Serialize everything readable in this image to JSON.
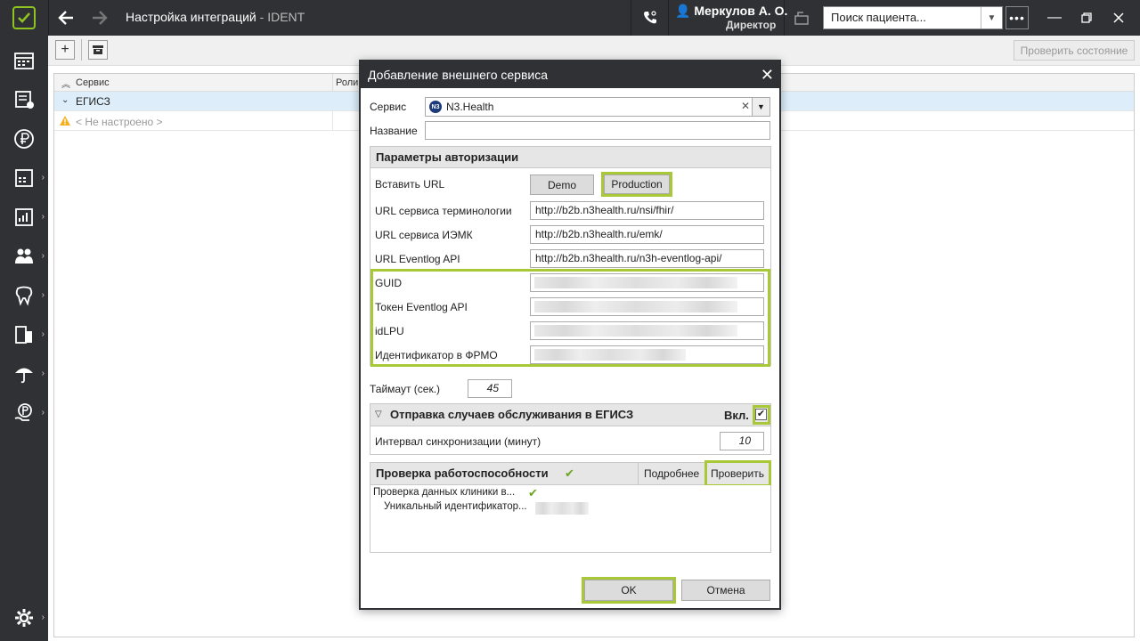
{
  "window": {
    "title": "Настройка интеграций",
    "app": "- IDENT",
    "user_name": "Меркулов А. О.",
    "user_role": "Директор",
    "search_placeholder": "Поиск пациента..."
  },
  "toolbar": {
    "check_state_label": "Проверить состояние"
  },
  "grid": {
    "columns": [
      "Сервис",
      "Роли"
    ],
    "group_row": "ЕГИСЗ",
    "item_row": "< Не настроено >"
  },
  "dialog": {
    "title": "Добавление внешнего сервиса",
    "service_label": "Сервис",
    "service_badge": "N3",
    "service_value": "N3.Health",
    "name_label": "Название",
    "name_value": "",
    "auth_group_title": "Параметры авторизации",
    "insert_url_label": "Вставить URL",
    "demo_button": "Demo",
    "production_button": "Production",
    "fields": [
      {
        "label": "URL сервиса терминологии",
        "value": "http://b2b.n3health.ru/nsi/fhir/"
      },
      {
        "label": "URL сервиса ИЭМК",
        "value": "http://b2b.n3health.ru/emk/"
      },
      {
        "label": "URL Eventlog API",
        "value": "http://b2b.n3health.ru/n3h-eventlog-api/"
      }
    ],
    "secret_fields": [
      {
        "label": "GUID"
      },
      {
        "label": "Токен Eventlog API"
      },
      {
        "label": "idLPU"
      },
      {
        "label": "Идентификатор в ФРМО"
      }
    ],
    "timeout_label": "Таймаут (сек.)",
    "timeout_value": "45",
    "send_group_title": "Отправка случаев обслуживания в ЕГИСЗ",
    "send_enabled_label": "Вкл.",
    "sync_interval_label": "Интервал синхронизации (минут)",
    "sync_interval_value": "10",
    "health_group_title": "Проверка работоспособности",
    "details_button": "Подробнее",
    "check_button": "Проверить",
    "check_item_1": "Проверка данных клиники в...",
    "check_item_2": "Уникальный идентификатор...",
    "ok_button": "OK",
    "cancel_button": "Отмена"
  },
  "colors": {
    "accent": "#a8c838",
    "dark": "#303134",
    "check_green": "#6ca51f"
  }
}
